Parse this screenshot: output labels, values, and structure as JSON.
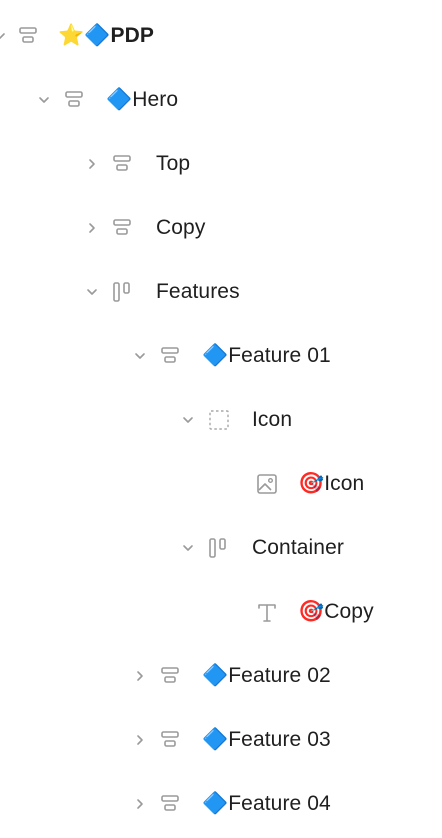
{
  "tree": {
    "rows": [
      {
        "label": "⭐🔷PDP",
        "icon": "stack-icon",
        "expanded": true
      },
      {
        "label": "🔷Hero",
        "icon": "stack-icon",
        "expanded": true
      },
      {
        "label": "Top",
        "icon": "stack-icon",
        "expanded": false
      },
      {
        "label": "Copy",
        "icon": "stack-icon",
        "expanded": false
      },
      {
        "label": "Features",
        "icon": "columns-icon",
        "expanded": true
      },
      {
        "label": "🔷Feature 01",
        "icon": "stack-icon",
        "expanded": true
      },
      {
        "label": "Icon",
        "icon": "frame-icon",
        "expanded": true
      },
      {
        "label": "🎯Icon",
        "icon": "image-icon"
      },
      {
        "label": "Container",
        "icon": "columns-icon",
        "expanded": true
      },
      {
        "label": "🎯Copy",
        "icon": "text-icon"
      },
      {
        "label": "🔷Feature 02",
        "icon": "stack-icon",
        "expanded": false
      },
      {
        "label": "🔷Feature 03",
        "icon": "stack-icon",
        "expanded": false
      },
      {
        "label": "🔷Feature 04",
        "icon": "stack-icon",
        "expanded": false
      }
    ]
  }
}
